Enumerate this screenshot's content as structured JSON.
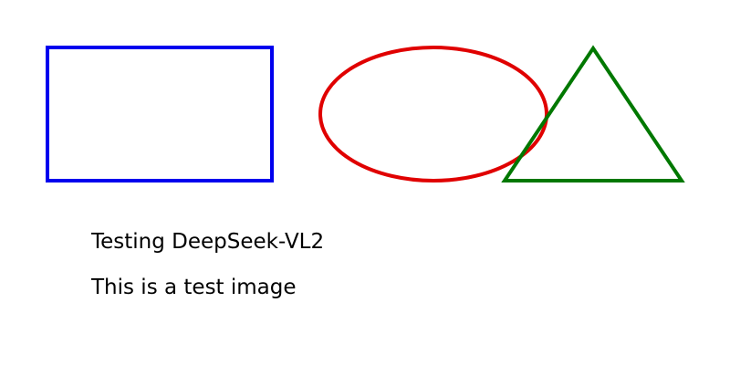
{
  "shapes": {
    "rectangle": {
      "stroke": "#0000ee"
    },
    "ellipse": {
      "stroke": "#e00000"
    },
    "triangle": {
      "stroke": "#007800"
    }
  },
  "text": {
    "line1": "Testing DeepSeek-VL2",
    "line2": "This is a test image"
  }
}
